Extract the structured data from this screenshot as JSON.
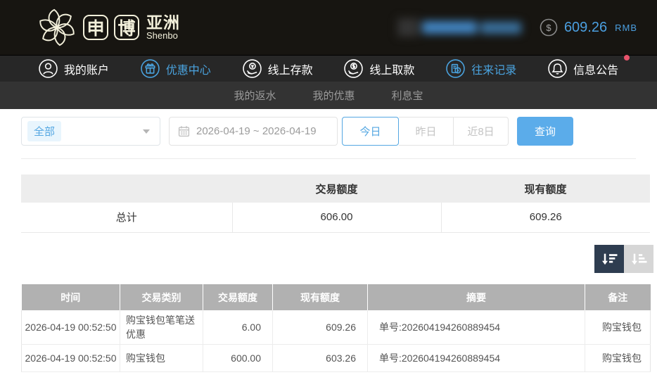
{
  "brand": {
    "logo_char_1": "申",
    "logo_char_2": "博",
    "region": "亚洲",
    "name_en": "Shenbo"
  },
  "account": {
    "currency_symbol": "$",
    "balance": "609.26",
    "currency": "RMB"
  },
  "nav": {
    "items": [
      {
        "label": "我的账户",
        "icon": "user-icon",
        "active": false
      },
      {
        "label": "优惠中心",
        "icon": "gift-icon",
        "active": true
      },
      {
        "label": "线上存款",
        "icon": "deposit-icon",
        "active": false
      },
      {
        "label": "线上取款",
        "icon": "withdraw-icon",
        "active": false
      },
      {
        "label": "往来记录",
        "icon": "records-icon",
        "active": true
      },
      {
        "label": "信息公告",
        "icon": "bell-icon",
        "active": false,
        "badge": true
      }
    ]
  },
  "subnav": {
    "items": [
      {
        "label": "我的返水"
      },
      {
        "label": "我的优惠"
      },
      {
        "label": "利息宝"
      }
    ]
  },
  "filters": {
    "type_selected": "全部",
    "date_range": "2026-04-19 ~ 2026-04-19",
    "quick_buttons": [
      {
        "label": "今日",
        "active": true
      },
      {
        "label": "昨日",
        "active": false
      },
      {
        "label": "近8日",
        "active": false
      }
    ],
    "search_label": "查询"
  },
  "summary": {
    "col_transaction": "交易额度",
    "col_balance": "现有额度",
    "total_label": "总计",
    "total_transaction": "606.00",
    "total_balance": "609.26"
  },
  "records": {
    "headers": [
      "时间",
      "交易类别",
      "交易额度",
      "现有额度",
      "摘要",
      "备注"
    ],
    "rows": [
      {
        "time": "2026-04-19 00:52:50",
        "type": "购宝钱包笔笔送优惠",
        "amount": "6.00",
        "balance": "609.26",
        "summary": "单号:202604194260889454",
        "note": "购宝钱包"
      },
      {
        "time": "2026-04-19 00:52:50",
        "type": "购宝钱包",
        "amount": "600.00",
        "balance": "603.26",
        "summary": "单号:202604194260889454",
        "note": "购宝钱包"
      }
    ]
  },
  "colors": {
    "accent": "#4aa3df",
    "search_button": "#5bacea",
    "sort_active_bg": "#2e3d50",
    "badge": "#e8546b",
    "header_bg": "#171511"
  }
}
